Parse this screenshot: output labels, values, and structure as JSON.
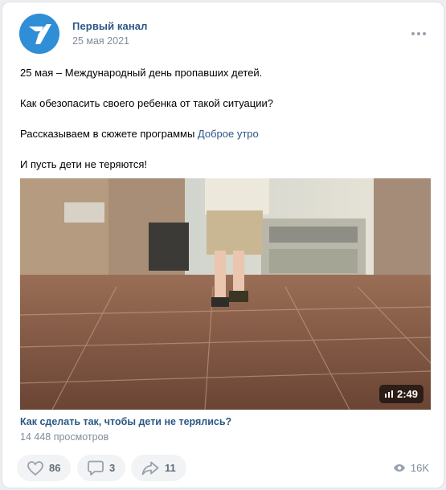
{
  "post": {
    "author": "Первый канал",
    "date": "25 мая 2021",
    "paragraphs": [
      "25 мая – Международный день пропавших детей.",
      "Как обезопасить своего ребенка от такой ситуации?",
      "Рассказываем в сюжете программы ",
      "И пусть дети не теряются!"
    ],
    "link_text": "Доброе утро"
  },
  "video": {
    "duration": "2:49",
    "title": "Как сделать так, чтобы дети не терялись?",
    "views": "14 448 просмотров"
  },
  "actions": {
    "likes": "86",
    "comments": "3",
    "shares": "11",
    "views": "16K"
  },
  "colors": {
    "link": "#2a5885",
    "secondary": "#818c99",
    "pill_bg": "#f2f3f5",
    "avatar": "#2f8ed6"
  },
  "icons": [
    "channel-one-logo",
    "more-icon",
    "video-quality-icon",
    "heart-icon",
    "comment-icon",
    "share-icon",
    "eye-icon"
  ]
}
